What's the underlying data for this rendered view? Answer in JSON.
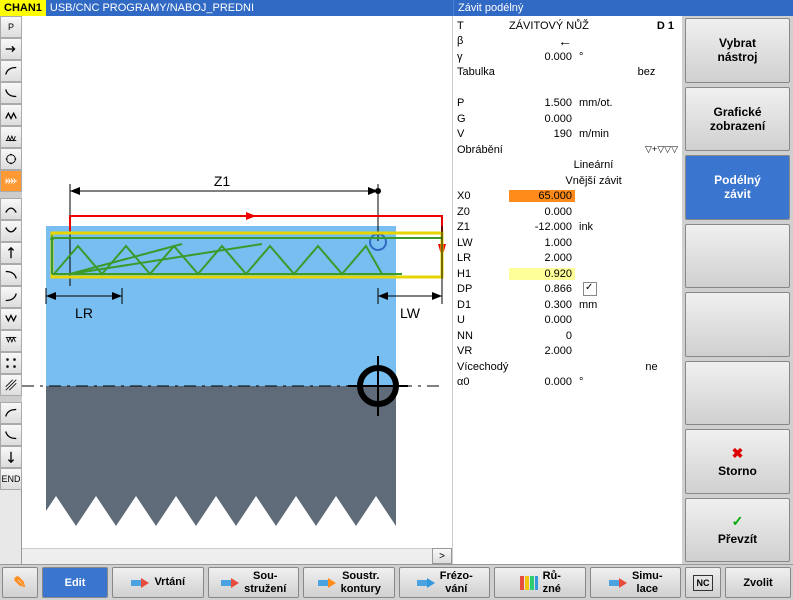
{
  "header": {
    "chan": "CHAN1",
    "path": "USB/CNC PROGRAMY/NABOJ_PREDNI",
    "title": "Závit podélný"
  },
  "params": {
    "T": {
      "label": "T",
      "value": "ZÁVITOVÝ NŮŽ",
      "d": "D 1"
    },
    "beta": {
      "label": "β",
      "value": "←"
    },
    "gamma": {
      "label": "γ",
      "value": "0.000",
      "unit": "°"
    },
    "Tabulka": {
      "label": "Tabulka",
      "value": "bez"
    },
    "P": {
      "label": "P",
      "value": "1.500",
      "unit": "mm/ot."
    },
    "G": {
      "label": "G",
      "value": "0.000"
    },
    "V": {
      "label": "V",
      "value": "190",
      "unit": "m/min"
    },
    "Obrabeni": {
      "label": "Obrábění",
      "sym": "▽+▽▽▽"
    },
    "mode1": "Lineární",
    "mode2": "Vnější závit",
    "X0": {
      "label": "X0",
      "value": "65.000"
    },
    "Z0": {
      "label": "Z0",
      "value": "0.000"
    },
    "Z1": {
      "label": "Z1",
      "value": "-12.000",
      "unit": "ink"
    },
    "LW": {
      "label": "LW",
      "value": "1.000"
    },
    "LR": {
      "label": "LR",
      "value": "2.000"
    },
    "H1": {
      "label": "H1",
      "value": "0.920"
    },
    "DP": {
      "label": "DP",
      "value": "0.866"
    },
    "D1": {
      "label": "D1",
      "value": "0.300",
      "unit": "mm"
    },
    "U": {
      "label": "U",
      "value": "0.000"
    },
    "NN": {
      "label": "NN",
      "value": "0"
    },
    "VR": {
      "label": "VR",
      "value": "2.000"
    },
    "Vicechody": {
      "label": "Vícechodý",
      "value": "ne"
    },
    "alpha0": {
      "label": "α0",
      "value": "0.000",
      "unit": "°"
    }
  },
  "canvas": {
    "label_Z1": "Z1",
    "label_LR": "LR",
    "label_LW": "LW"
  },
  "softkeys_v": [
    {
      "label": "Vybrat\nnástroj"
    },
    {
      "label": "Grafické\nzobrazení"
    },
    {
      "label": "Podélný\nzávit",
      "active": true
    },
    {
      "label": ""
    },
    {
      "label": ""
    },
    {
      "label": ""
    },
    {
      "label": "Storno",
      "icon": "✖",
      "iconClass": "red"
    },
    {
      "label": "Převzít",
      "icon": "✓",
      "iconClass": "green"
    }
  ],
  "softkeys_h": {
    "edit_icon": "✎",
    "edit": "Edit",
    "items": [
      {
        "label": "Vrtání",
        "color": "#e74c3c"
      },
      {
        "label": "Sou-\nstružení",
        "color": "#e74c3c"
      },
      {
        "label": "Soustr.\nkontury",
        "color": "#ff8c1a"
      },
      {
        "label": "Frézo-\nvání",
        "color": "#3498db"
      },
      {
        "label": "Rů-\nzné",
        "color": "rainbow"
      },
      {
        "label": "Simu-\nlace",
        "color": "#e74c3c"
      }
    ],
    "nc_icon": "NC",
    "zvolit": "Zvolit"
  }
}
